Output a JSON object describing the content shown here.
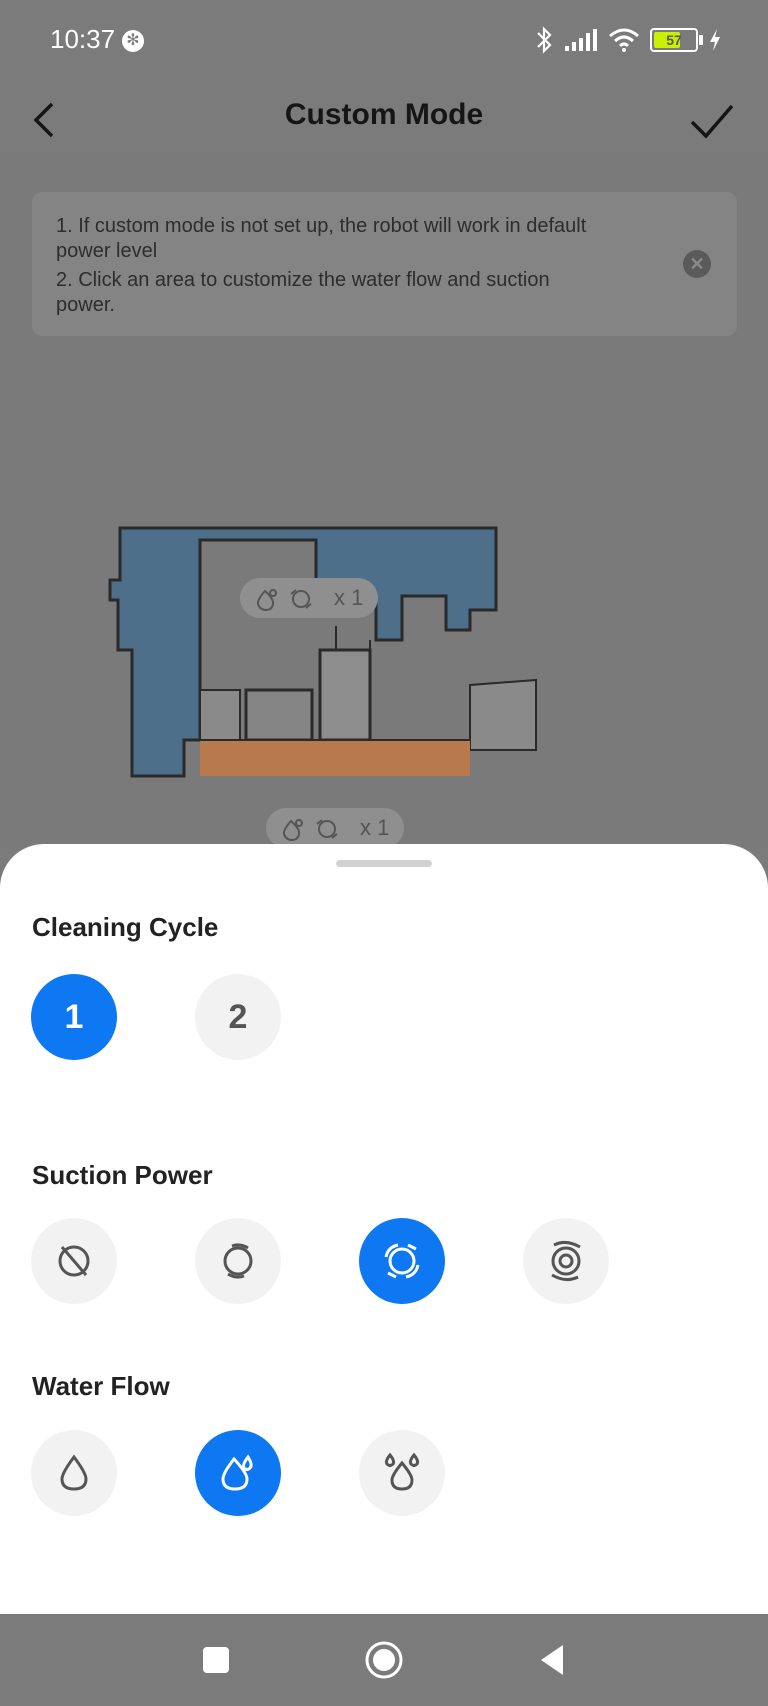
{
  "status_bar": {
    "time": "10:37",
    "battery": "57"
  },
  "header": {
    "title": "Custom Mode"
  },
  "tip": {
    "line1a": "1. If custom mode is not set up, the robot will work in default",
    "line1b": "power level",
    "line2a": "2. Click an area to customize the water flow and suction",
    "line2b": "power."
  },
  "map": {
    "room1_badge": "x 1",
    "room2_badge": "x 1",
    "colors": {
      "room_blue": "#4d6f8a",
      "room_orange": "#b87a4d"
    }
  },
  "sheet": {
    "cleaning_cycle": {
      "title": "Cleaning Cycle",
      "options": [
        "1",
        "2"
      ],
      "selected": "1"
    },
    "suction_power": {
      "title": "Suction Power",
      "options": [
        "suction-off-icon",
        "suction-quiet-icon",
        "suction-standard-icon",
        "suction-max-icon"
      ],
      "selected": "suction-standard-icon"
    },
    "water_flow": {
      "title": "Water Flow",
      "options": [
        "water-low-icon",
        "water-medium-icon",
        "water-high-icon"
      ],
      "selected": "water-medium-icon"
    }
  },
  "colors": {
    "accent": "#0d78f2",
    "option_bg": "#f2f2f2"
  }
}
